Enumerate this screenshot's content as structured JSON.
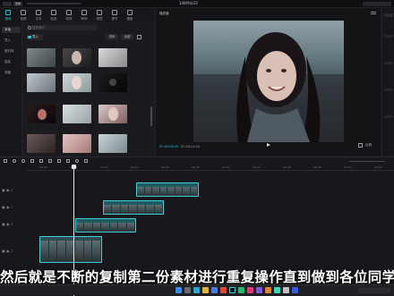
{
  "topbar": {
    "menu_label": "菜单",
    "clock": "14时9分23"
  },
  "toolbar": {
    "tools": [
      {
        "label": "媒体",
        "icon": "media-icon",
        "active": true
      },
      {
        "label": "音频",
        "icon": "audio-icon"
      },
      {
        "label": "文本",
        "icon": "text-icon"
      },
      {
        "label": "贴纸",
        "icon": "sticker-icon"
      },
      {
        "label": "特效",
        "icon": "effects-icon"
      },
      {
        "label": "转场",
        "icon": "transition-icon"
      },
      {
        "label": "滤镜",
        "icon": "filter-icon"
      },
      {
        "label": "调节",
        "icon": "adjust-icon"
      },
      {
        "label": "模板",
        "icon": "template-icon"
      }
    ]
  },
  "sidenav": {
    "items": [
      {
        "label": "本地",
        "active": true
      },
      {
        "label": "导入"
      },
      {
        "label": "素材库"
      },
      {
        "label": "智能"
      },
      {
        "label": "收藏"
      }
    ]
  },
  "media": {
    "search_placeholder": "搜索素材",
    "folder_label": "导入",
    "sort_label": "排序",
    "filter_label": "全部"
  },
  "player": {
    "title": "播放器",
    "time_current": "00:00:08:20",
    "time_total": "00:00:24:20",
    "ratio_label": "比例"
  },
  "timeline": {
    "ruler_ticks": [
      "00:00",
      "00:05",
      "00:10",
      "00:15",
      "00:20",
      "00:25",
      "00:30",
      "00:35",
      "00:40",
      "00:45",
      "00:50",
      "00:55"
    ]
  },
  "subtitle": "然后就是不断的复制第二份素材进行重复操作直到做到各位同学"
}
